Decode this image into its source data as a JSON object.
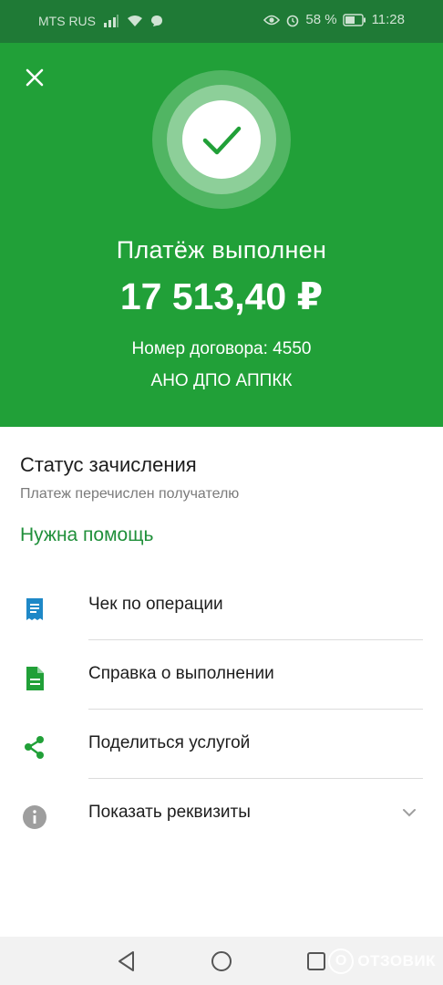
{
  "status_bar": {
    "carrier": "MTS RUS",
    "battery": "58 %",
    "time": "11:28",
    "icons": [
      "signal-icon",
      "wifi-icon",
      "chat-icon",
      "eye-icon",
      "alarm-icon",
      "battery-icon"
    ]
  },
  "hero": {
    "title": "Платёж выполнен",
    "amount": "17 513,40 ₽",
    "contract": "Номер договора: 4550",
    "organization": "АНО ДПО АППКК",
    "icons": [
      "close-icon",
      "checkmark-icon"
    ]
  },
  "status": {
    "title": "Статус зачисления",
    "description": "Платеж перечислен получателю",
    "help_link": "Нужна помощь"
  },
  "actions": [
    {
      "label": "Чек по операции",
      "icon": "receipt-icon"
    },
    {
      "label": "Справка о выполнении",
      "icon": "document-icon"
    },
    {
      "label": "Поделиться услугой",
      "icon": "share-icon"
    },
    {
      "label": "Показать реквизиты",
      "icon": "info-icon"
    }
  ],
  "watermark": {
    "text": "ОТЗОВИК",
    "mark": "О"
  },
  "colors": {
    "hero_green": "#21a038",
    "status_green": "#1f7a36",
    "link_green": "#1f8f3a",
    "receipt_blue": "#1e88c7",
    "info_gray": "#9e9e9e"
  }
}
